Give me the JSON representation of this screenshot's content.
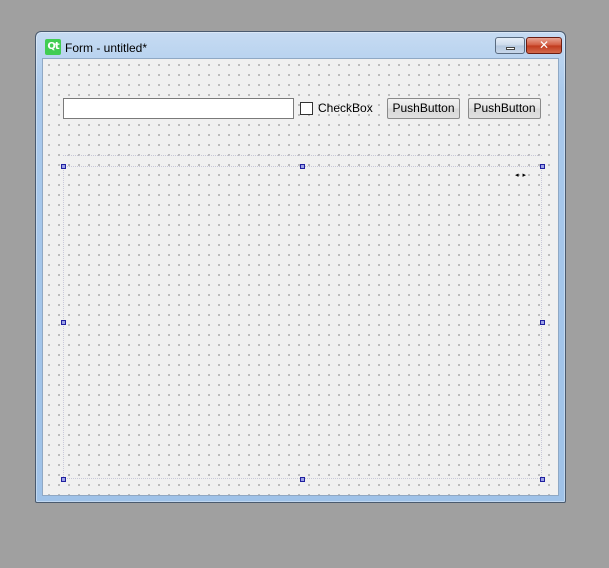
{
  "window": {
    "title": "Form - untitled*",
    "logo_text": "Qt",
    "close_glyph": "✕"
  },
  "form": {
    "line_edit_value": "",
    "checkbox_label": "CheckBox",
    "checkbox_checked": false,
    "push_buttons": [
      "PushButton",
      "PushButton"
    ]
  },
  "icons": {
    "splitter": "◂▸"
  },
  "colors": {
    "desktop": "#a0a0a0",
    "canvas": "#f0f0f0",
    "selection_handle": "#2020a0",
    "qt_logo": "#41cd52",
    "close_button": "#c0391d"
  }
}
